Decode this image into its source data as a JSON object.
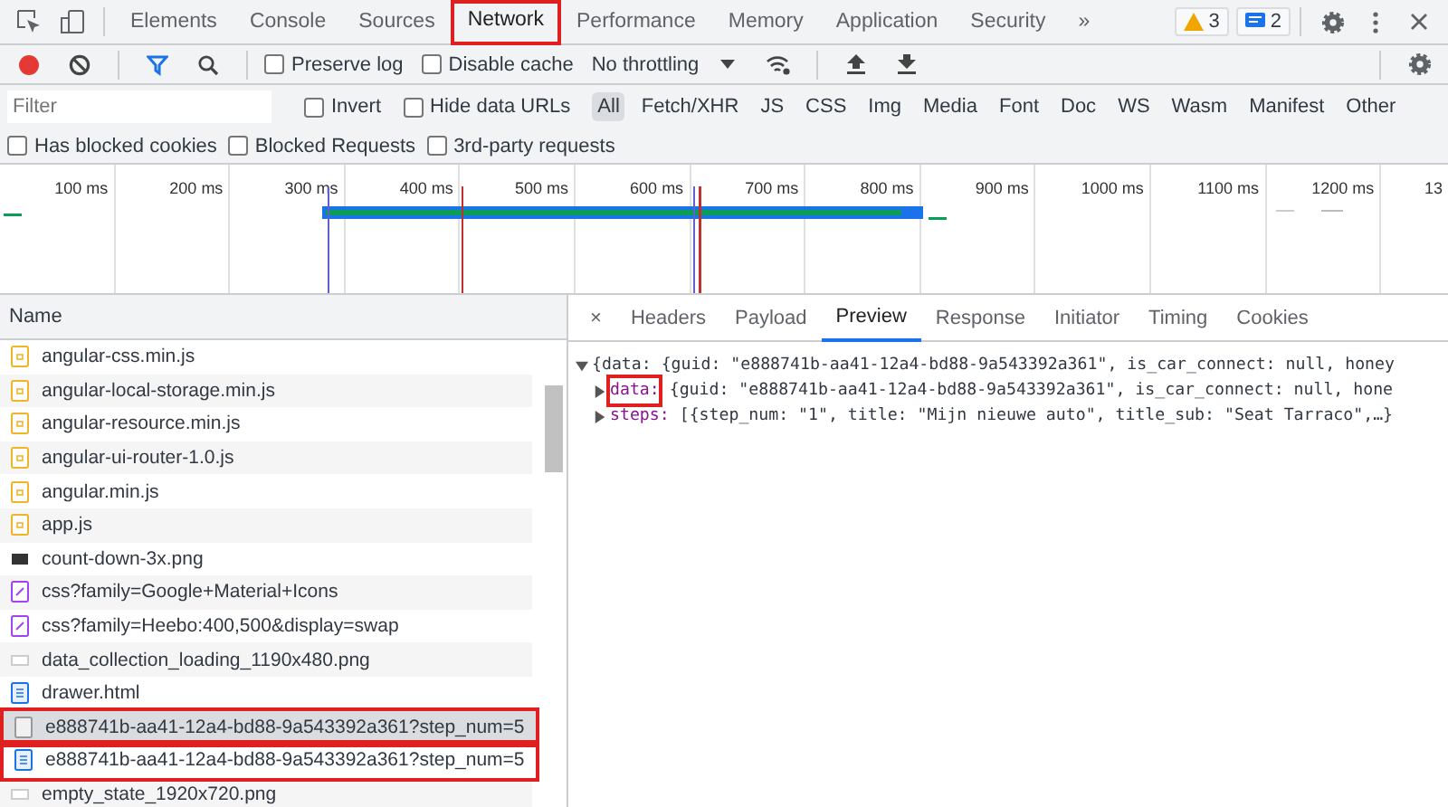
{
  "main_tabs": [
    {
      "label": "Elements",
      "selected": false,
      "highlighted": false
    },
    {
      "label": "Console",
      "selected": false,
      "highlighted": false
    },
    {
      "label": "Sources",
      "selected": false,
      "highlighted": false
    },
    {
      "label": "Network",
      "selected": true,
      "highlighted": true
    },
    {
      "label": "Performance",
      "selected": false,
      "highlighted": false
    },
    {
      "label": "Memory",
      "selected": false,
      "highlighted": false
    },
    {
      "label": "Application",
      "selected": false,
      "highlighted": false
    },
    {
      "label": "Security",
      "selected": false,
      "highlighted": false
    }
  ],
  "more_tabs": "»",
  "badges": [
    {
      "kind": "warning",
      "count": "3"
    },
    {
      "kind": "message",
      "count": "2"
    }
  ],
  "toolbar": {
    "recording": true,
    "filter_active": true,
    "checkboxes": [
      {
        "label": "Preserve log",
        "checked": false
      },
      {
        "label": "Disable cache",
        "checked": false
      }
    ],
    "throttling": "No throttling"
  },
  "filter": {
    "placeholder": "Filter",
    "checkboxes": [
      {
        "label": "Invert",
        "checked": false
      },
      {
        "label": "Hide data URLs",
        "checked": false
      }
    ],
    "types": [
      {
        "label": "All",
        "selected": true
      },
      {
        "label": "Fetch/XHR",
        "selected": false
      },
      {
        "label": "JS",
        "selected": false
      },
      {
        "label": "CSS",
        "selected": false
      },
      {
        "label": "Img",
        "selected": false
      },
      {
        "label": "Media",
        "selected": false
      },
      {
        "label": "Font",
        "selected": false
      },
      {
        "label": "Doc",
        "selected": false
      },
      {
        "label": "WS",
        "selected": false
      },
      {
        "label": "Wasm",
        "selected": false
      },
      {
        "label": "Manifest",
        "selected": false
      },
      {
        "label": "Other",
        "selected": false
      }
    ]
  },
  "extra_filters": [
    {
      "label": "Has blocked cookies",
      "checked": false
    },
    {
      "label": "Blocked Requests",
      "checked": false
    },
    {
      "label": "3rd-party requests",
      "checked": false
    }
  ],
  "timeline": {
    "ticks": [
      "100 ms",
      "200 ms",
      "300 ms",
      "400 ms",
      "500 ms",
      "600 ms",
      "700 ms",
      "800 ms",
      "900 ms",
      "1000 ms",
      "1100 ms",
      "1200 ms",
      "13"
    ]
  },
  "requests": {
    "column": "Name",
    "rows": [
      {
        "name": "angular-css.min.js",
        "kind": "script",
        "selected": false,
        "highlighted": false
      },
      {
        "name": "angular-local-storage.min.js",
        "kind": "script",
        "selected": false,
        "highlighted": false
      },
      {
        "name": "angular-resource.min.js",
        "kind": "script",
        "selected": false,
        "highlighted": false
      },
      {
        "name": "angular-ui-router-1.0.js",
        "kind": "script",
        "selected": false,
        "highlighted": false
      },
      {
        "name": "angular.min.js",
        "kind": "script",
        "selected": false,
        "highlighted": false
      },
      {
        "name": "app.js",
        "kind": "script",
        "selected": false,
        "highlighted": false
      },
      {
        "name": "count-down-3x.png",
        "kind": "image-dark",
        "selected": false,
        "highlighted": false
      },
      {
        "name": "css?family=Google+Material+Icons",
        "kind": "stylesheet",
        "selected": false,
        "highlighted": false
      },
      {
        "name": "css?family=Heebo:400,500&display=swap",
        "kind": "stylesheet",
        "selected": false,
        "highlighted": false
      },
      {
        "name": "data_collection_loading_1190x480.png",
        "kind": "image",
        "selected": false,
        "highlighted": false
      },
      {
        "name": "drawer.html",
        "kind": "document",
        "selected": false,
        "highlighted": false
      },
      {
        "name": "e888741b-aa41-12a4-bd88-9a543392a361?step_num=5",
        "kind": "blank",
        "selected": true,
        "highlighted": true
      },
      {
        "name": "e888741b-aa41-12a4-bd88-9a543392a361?step_num=5",
        "kind": "document",
        "selected": false,
        "highlighted": true
      },
      {
        "name": "empty_state_1920x720.png",
        "kind": "image",
        "selected": false,
        "highlighted": false
      }
    ]
  },
  "detail_tabs": [
    {
      "label": "Headers",
      "selected": false
    },
    {
      "label": "Payload",
      "selected": false
    },
    {
      "label": "Preview",
      "selected": true
    },
    {
      "label": "Response",
      "selected": false
    },
    {
      "label": "Initiator",
      "selected": false
    },
    {
      "label": "Timing",
      "selected": false
    },
    {
      "label": "Cookies",
      "selected": false
    }
  ],
  "close_glyph": "×",
  "preview": {
    "root": {
      "expanded": true,
      "text": "{data: {guid: \"e888741b-aa41-12a4-bd88-9a543392a361\", is_car_connect: null, honey"
    },
    "children": [
      {
        "key": "data:",
        "expanded": false,
        "highlighted": true,
        "value": "{guid: \"e888741b-aa41-12a4-bd88-9a543392a361\", is_car_connect: null, hone"
      },
      {
        "key": "steps:",
        "expanded": false,
        "highlighted": false,
        "value": "[{step_num: \"1\", title: \"Mijn nieuwe auto\", title_sub: \"Seat Tarraco\",…}"
      }
    ]
  }
}
